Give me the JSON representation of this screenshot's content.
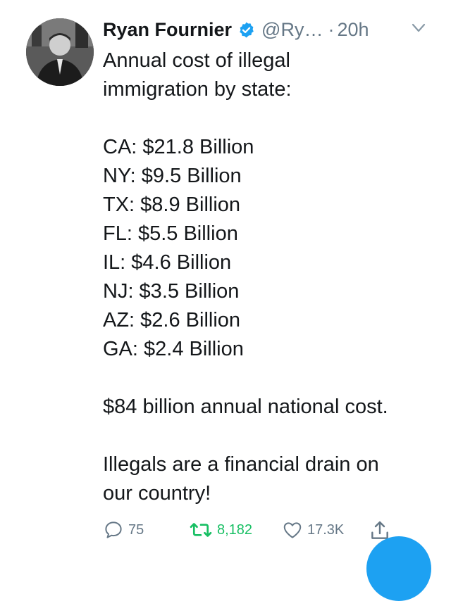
{
  "tweet": {
    "author_name": "Ryan Fournier",
    "handle": "@Ry…",
    "separator": "·",
    "time": "20h",
    "lines": [
      "Annual cost of illegal",
      "immigration by state:",
      "",
      "CA: $21.8 Billion",
      "NY: $9.5 Billion",
      "TX: $8.9 Billion",
      "FL: $5.5 Billion",
      "IL: $4.6 Billion",
      "NJ: $3.5 Billion",
      "AZ: $2.6 Billion",
      "GA: $2.4 Billion",
      "",
      "$84 billion annual national cost.",
      "",
      "Illegals are a financial drain on",
      "our country!"
    ]
  },
  "actions": {
    "reply_count": "75",
    "retweet_count": "8,182",
    "like_count": "17.3K"
  },
  "icons": {
    "verified": "verified-badge-icon",
    "menu": "chevron-down-icon",
    "reply": "reply-icon",
    "retweet": "retweet-icon",
    "like": "heart-icon",
    "share": "share-icon"
  },
  "colors": {
    "verified_blue": "#1da1f2",
    "retweet_green": "#17bf63",
    "secondary_text": "#657786",
    "compose_button": "#1da1f2"
  }
}
